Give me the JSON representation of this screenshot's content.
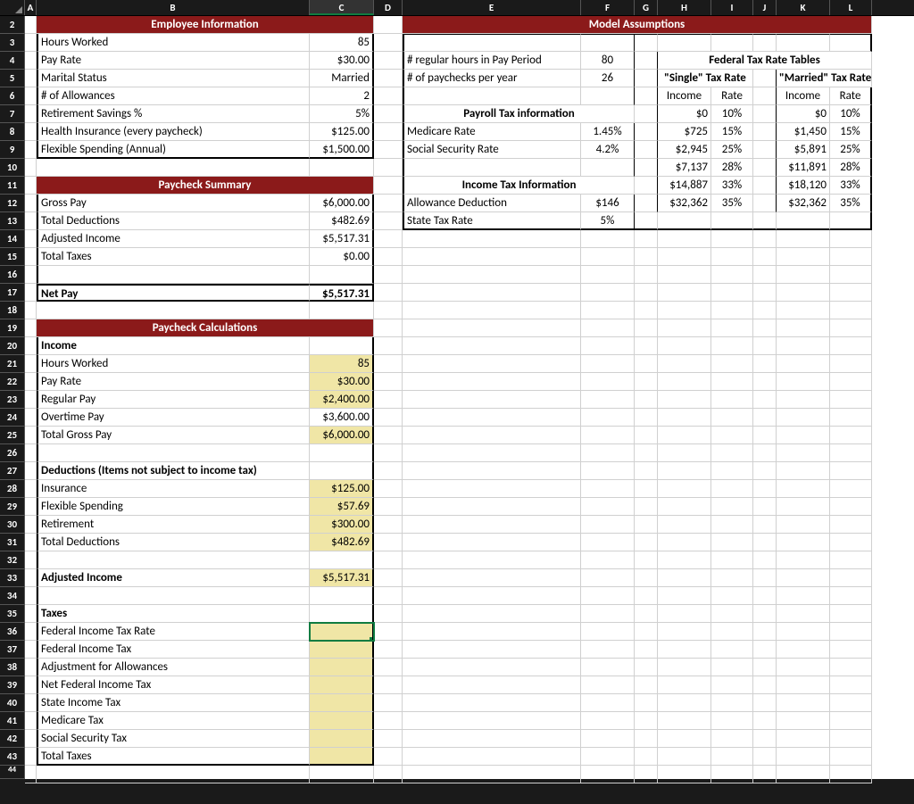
{
  "columns": [
    "A",
    "B",
    "C",
    "D",
    "E",
    "F",
    "G",
    "H",
    "I",
    "J",
    "K",
    "L"
  ],
  "rowStart": 2,
  "rowEnd": 44,
  "selected": {
    "col": "C",
    "row": 36
  },
  "headers": {
    "emp_info": "Employee Information",
    "model": "Model Assumptions",
    "paycheck_sum": "Paycheck Summary",
    "paycheck_calc": "Paycheck Calculations",
    "fed_tables": "Federal Tax Rate Tables",
    "payroll_tax": "Payroll Tax information",
    "income_tax": "Income Tax Information"
  },
  "emp": {
    "hours_l": "Hours Worked",
    "hours_v": "85",
    "rate_l": "Pay Rate",
    "rate_v": "$30.00",
    "marital_l": "Marital Status",
    "marital_v": "Married",
    "allow_l": "# of Allowances",
    "allow_v": "2",
    "ret_l": "Retirement Savings %",
    "ret_v": "5%",
    "ins_l": "Health Insurance (every paycheck)",
    "ins_v": "$125.00",
    "flex_l": "Flexible Spending (Annual)",
    "flex_v": "$1,500.00"
  },
  "summary": {
    "gross_l": "Gross Pay",
    "gross_v": "$6,000.00",
    "ded_l": "Total Deductions",
    "ded_v": "$482.69",
    "adj_l": "Adjusted Income",
    "adj_v": "$5,517.31",
    "tax_l": "Total Taxes",
    "tax_v": "$0.00",
    "net_l": "Net Pay",
    "net_v": "$5,517.31"
  },
  "calc": {
    "income_h": "Income",
    "hours_l": "Hours Worked",
    "hours_v": "85",
    "rate_l": "Pay Rate",
    "rate_v": "$30.00",
    "reg_l": "Regular Pay",
    "reg_v": "$2,400.00",
    "ot_l": "Overtime Pay",
    "ot_v": "$3,600.00",
    "gross_l": "Total Gross Pay",
    "gross_v": "$6,000.00",
    "ded_h": "Deductions (Items not subject to income tax)",
    "insc_l": "Insurance",
    "insc_v": "$125.00",
    "flexc_l": "Flexible Spending",
    "flexc_v": "$57.69",
    "retc_l": "Retirement",
    "retc_v": "$300.00",
    "tded_l": "Total Deductions",
    "tded_v": "$482.69",
    "adjc_l": "Adjusted Income",
    "adjc_v": "$5,517.31",
    "taxes_h": "Taxes",
    "fedrate_l": "Federal Income Tax Rate",
    "fedtax_l": "Federal Income Tax",
    "adjallow_l": "Adjustment for Allowances",
    "netfed_l": "Net Federal Income Tax",
    "state_l": "State Income Tax",
    "med_l": "Medicare Tax",
    "ss_l": "Social Security Tax",
    "ttax_l": "Total Taxes"
  },
  "model": {
    "reg_l": "# regular hours in Pay Period",
    "reg_v": "80",
    "paychecks_l": "# of paychecks per year",
    "paychecks_v": "26",
    "medrate_l": "Medicare Rate",
    "medrate_v": "1.45%",
    "ssrate_l": "Social Security Rate",
    "ssrate_v": "4.2%",
    "allowded_l": "Allowance Deduction",
    "allowded_v": "$146",
    "statetax_l": "State Tax Rate",
    "statetax_v": "5%"
  },
  "rates": {
    "single_h": "\"Single\" Tax Rate",
    "married_h": "\"Married\" Tax Rate",
    "inc_h": "Income",
    "rate_h": "Rate",
    "single": [
      {
        "inc": "$0",
        "rate": "10%"
      },
      {
        "inc": "$725",
        "rate": "15%"
      },
      {
        "inc": "$2,945",
        "rate": "25%"
      },
      {
        "inc": "$7,137",
        "rate": "28%"
      },
      {
        "inc": "$14,887",
        "rate": "33%"
      },
      {
        "inc": "$32,362",
        "rate": "35%"
      }
    ],
    "married": [
      {
        "inc": "$0",
        "rate": "10%"
      },
      {
        "inc": "$1,450",
        "rate": "15%"
      },
      {
        "inc": "$5,891",
        "rate": "25%"
      },
      {
        "inc": "$11,891",
        "rate": "28%"
      },
      {
        "inc": "$18,120",
        "rate": "33%"
      },
      {
        "inc": "$32,362",
        "rate": "35%"
      }
    ]
  }
}
